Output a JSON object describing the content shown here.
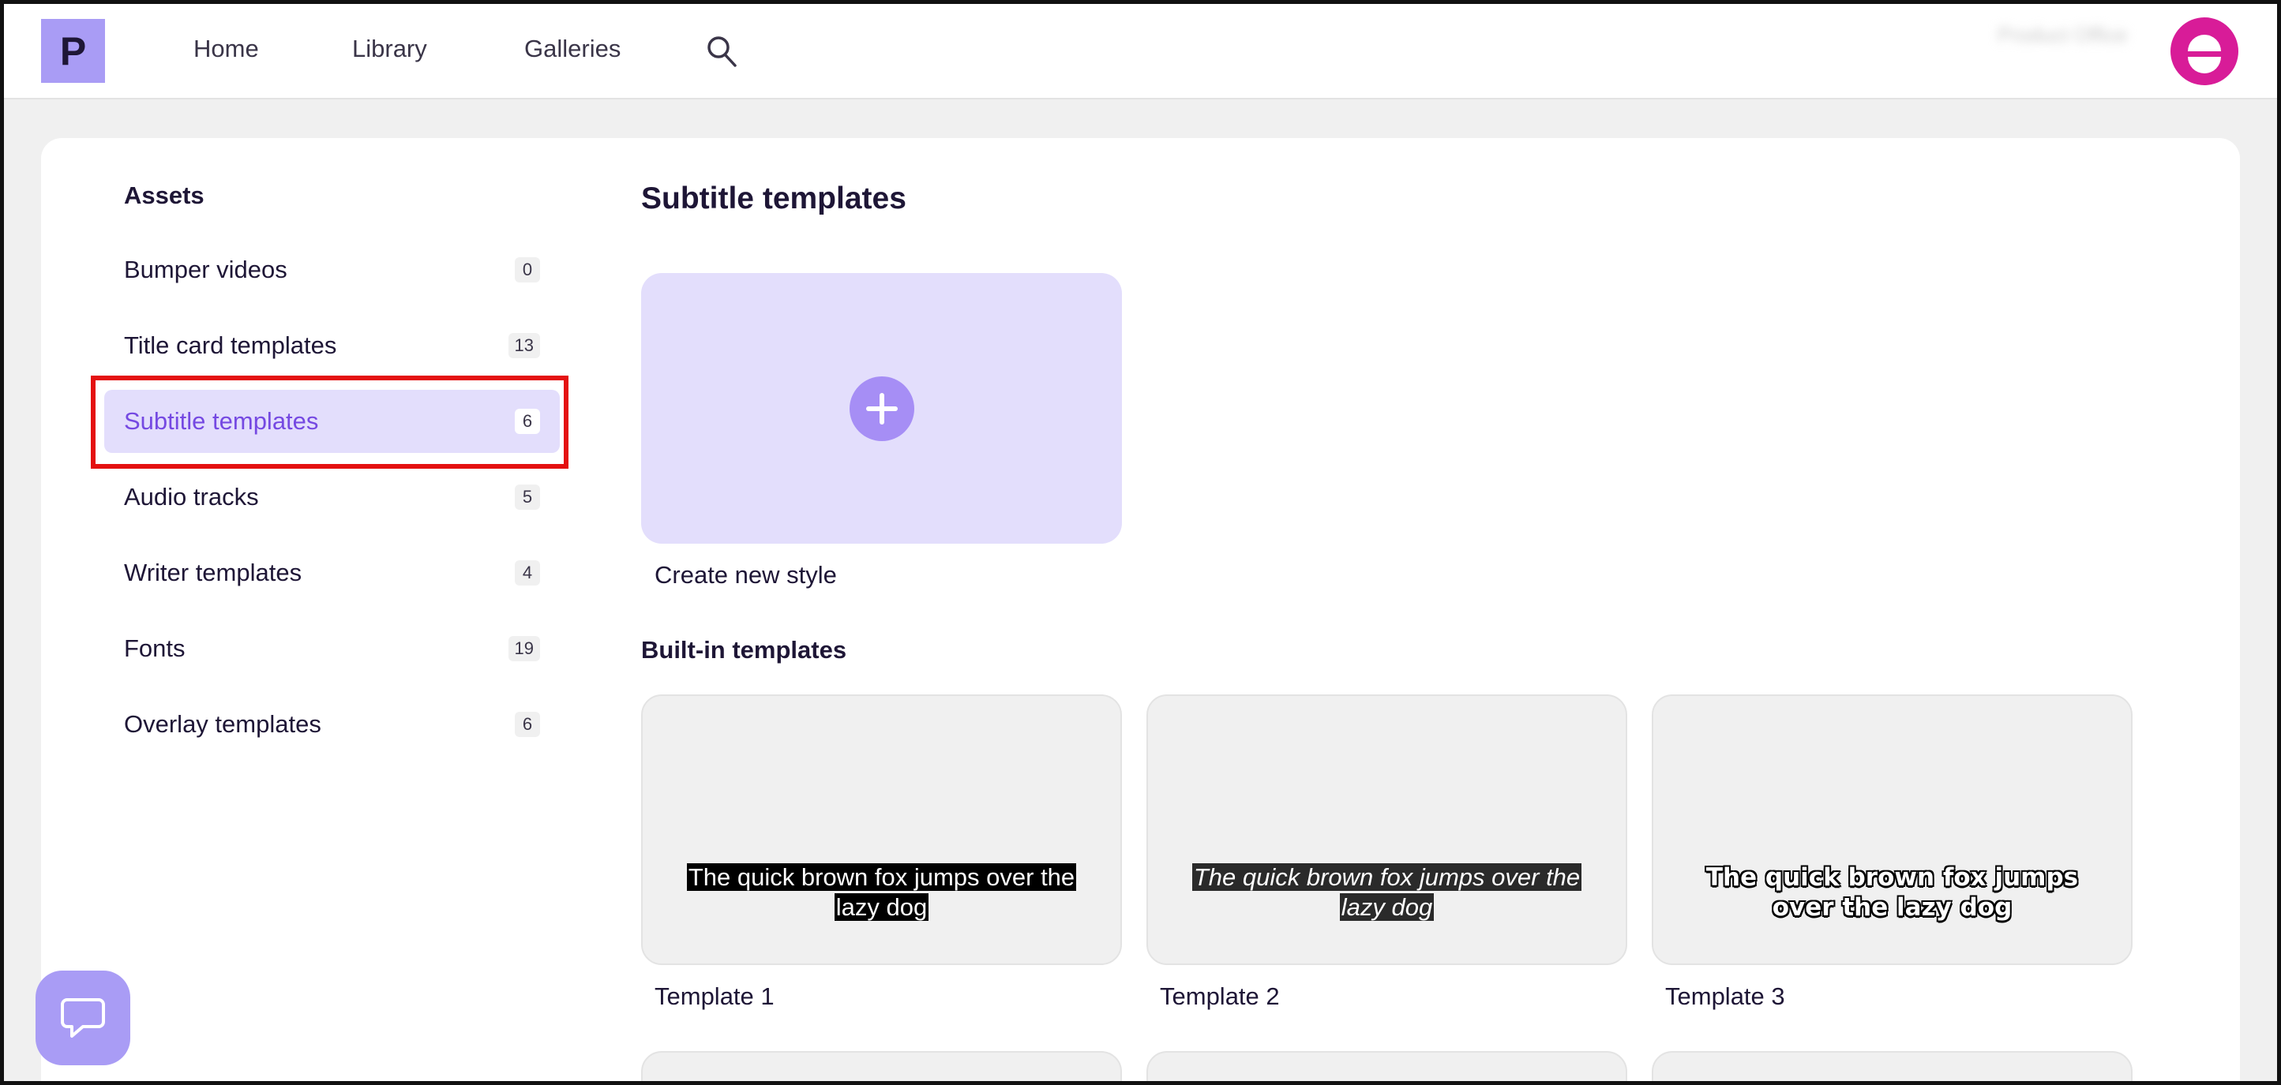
{
  "app": {
    "logo_letter": "P"
  },
  "nav": {
    "items": [
      {
        "label": "Home"
      },
      {
        "label": "Library"
      },
      {
        "label": "Galleries"
      }
    ],
    "search_icon": "search-icon",
    "user_name": "Product Office"
  },
  "sidebar": {
    "heading": "Assets",
    "items": [
      {
        "label": "Bumper videos",
        "count": "0"
      },
      {
        "label": "Title card templates",
        "count": "13"
      },
      {
        "label": "Subtitle templates",
        "count": "6"
      },
      {
        "label": "Audio tracks",
        "count": "5"
      },
      {
        "label": "Writer templates",
        "count": "4"
      },
      {
        "label": "Fonts",
        "count": "19"
      },
      {
        "label": "Overlay templates",
        "count": "6"
      }
    ],
    "active_index": 2
  },
  "main": {
    "title": "Subtitle templates",
    "create_label": "Create new style",
    "builtin_heading": "Built-in templates",
    "templates": [
      {
        "name": "Template 1",
        "sample_text": "The quick brown fox jumps over the lazy dog"
      },
      {
        "name": "Template 2",
        "sample_text": "The quick brown fox jumps over the lazy dog"
      },
      {
        "name": "Template 3",
        "sample_text": "The quick brown fox jumps over the lazy dog"
      }
    ]
  },
  "colors": {
    "accent": "#7549e2",
    "logo_bg": "#a99cf5",
    "avatar_bg": "#d81c98",
    "active_item_bg": "#e3defc",
    "highlight_border": "#e41111"
  }
}
